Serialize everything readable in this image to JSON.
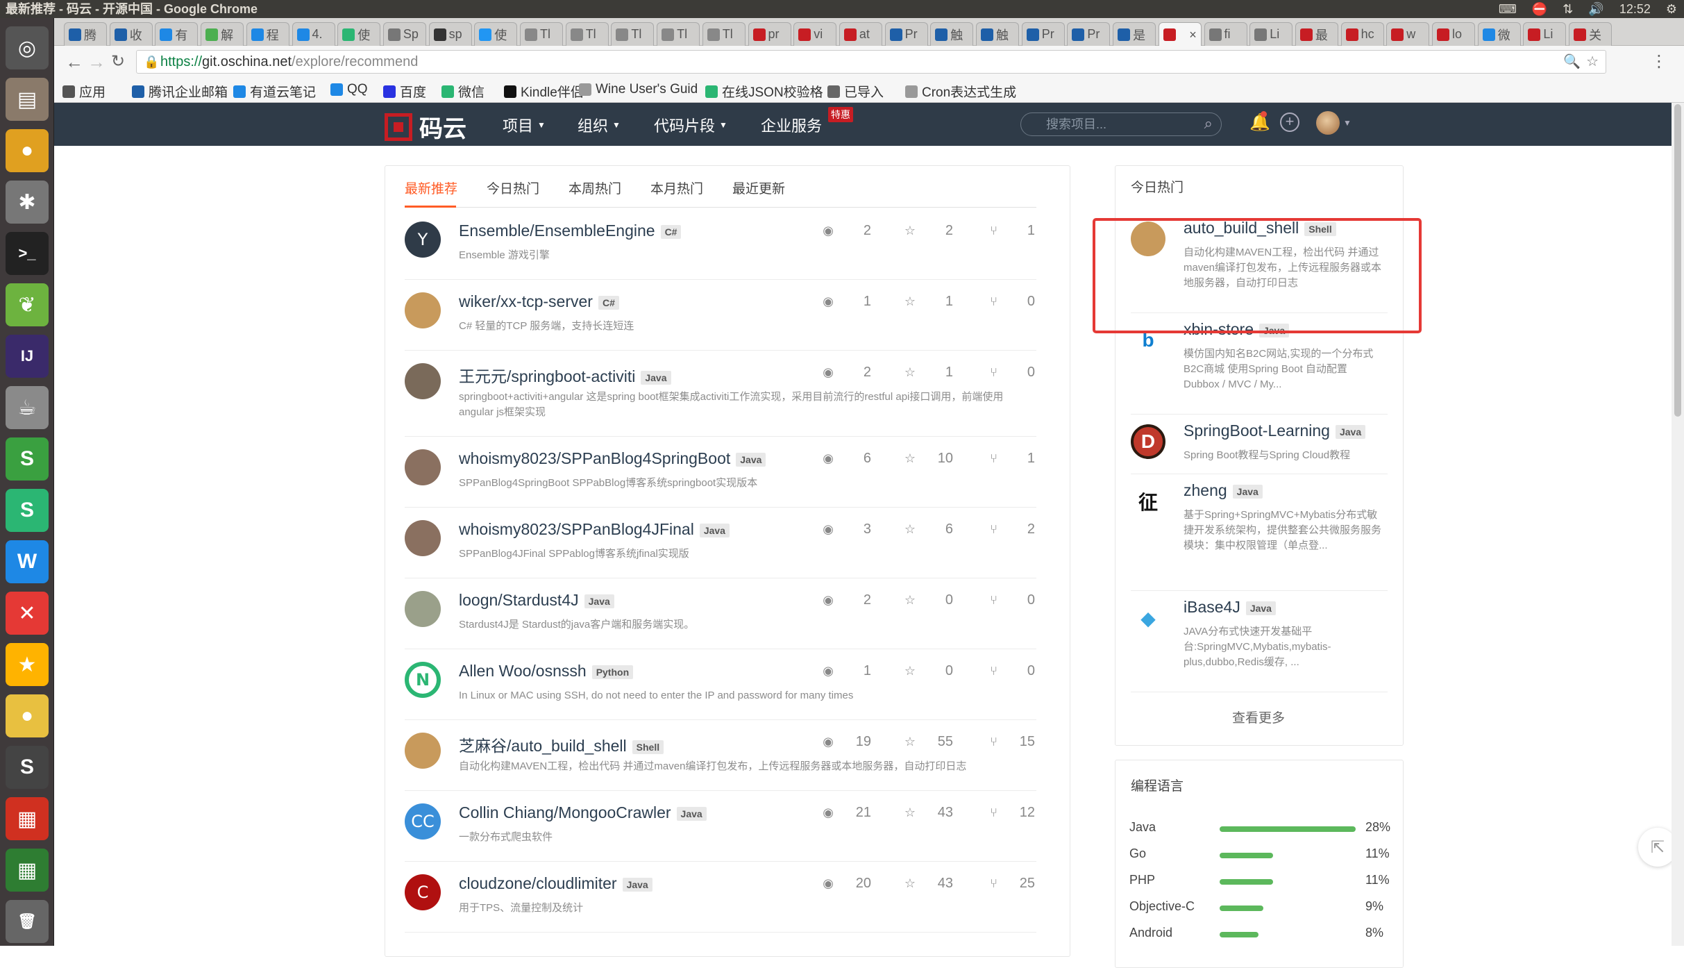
{
  "window_title": "最新推荐 - 码云 - 开源中国 - Google Chrome",
  "system_tray": {
    "time": "12:52"
  },
  "browser": {
    "tabs": [
      {
        "label": "腾",
        "color": "#1e5fa8"
      },
      {
        "label": "收",
        "color": "#1e5fa8"
      },
      {
        "label": "有",
        "color": "#1e88e5"
      },
      {
        "label": "解",
        "color": "#4caf50"
      },
      {
        "label": "程",
        "color": "#1e88e5"
      },
      {
        "label": "4.",
        "color": "#1e88e5"
      },
      {
        "label": "使",
        "color": "#2bb673"
      },
      {
        "label": "Sp",
        "color": "#777"
      },
      {
        "label": "sp",
        "color": "#333"
      },
      {
        "label": "使",
        "color": "#2196f3"
      },
      {
        "label": "Tl",
        "color": "#888"
      },
      {
        "label": "Tl",
        "color": "#888"
      },
      {
        "label": "Tl",
        "color": "#888"
      },
      {
        "label": "Tl",
        "color": "#888"
      },
      {
        "label": "Tl",
        "color": "#888"
      },
      {
        "label": "pr",
        "color": "#c71d23"
      },
      {
        "label": "vi",
        "color": "#c71d23"
      },
      {
        "label": "at",
        "color": "#c71d23"
      },
      {
        "label": "Pr",
        "color": "#1e5fa8"
      },
      {
        "label": "触",
        "color": "#1e5fa8"
      },
      {
        "label": "触",
        "color": "#1e5fa8"
      },
      {
        "label": "Pr",
        "color": "#1e5fa8"
      },
      {
        "label": "Pr",
        "color": "#1e5fa8"
      },
      {
        "label": "是",
        "color": "#1e5fa8"
      },
      {
        "label": "",
        "color": "#c71d23",
        "active": true
      },
      {
        "label": "fi",
        "color": "#777"
      },
      {
        "label": "Li",
        "color": "#777"
      },
      {
        "label": "最",
        "color": "#c71d23"
      },
      {
        "label": "hc",
        "color": "#c71d23"
      },
      {
        "label": "w",
        "color": "#c71d23"
      },
      {
        "label": "lo",
        "color": "#c71d23"
      },
      {
        "label": "微",
        "color": "#1e88e5"
      },
      {
        "label": "Li",
        "color": "#c71d23"
      },
      {
        "label": "关",
        "color": "#c71d23"
      }
    ],
    "url_scheme": "https://",
    "url_host": "git.oschina.net",
    "url_path": "/explore/recommend",
    "bookmarks": [
      {
        "label": "应用",
        "color": "#555"
      },
      {
        "label": "腾讯企业邮箱",
        "color": "#1e5fa8"
      },
      {
        "label": "有道云笔记",
        "color": "#1e88e5"
      },
      {
        "label": "QQ",
        "color": "#1e88e5"
      },
      {
        "label": "百度",
        "color": "#2932e1"
      },
      {
        "label": "微信",
        "color": "#2bb673"
      },
      {
        "label": "Kindle伴侣",
        "color": "#111"
      },
      {
        "label": "Wine User's Guid",
        "color": "#999"
      },
      {
        "label": "在线JSON校验格",
        "color": "#2bb673"
      },
      {
        "label": "已导入",
        "color": "#666"
      },
      {
        "label": "Cron表达式生成",
        "color": "#999"
      }
    ]
  },
  "site": {
    "logo_text": "码云",
    "menus": [
      "项目",
      "组织",
      "代码片段",
      "企业服务"
    ],
    "hot_badge": "特惠",
    "search_placeholder": "搜索项目..."
  },
  "feed": {
    "tabs": [
      "最新推荐",
      "今日热门",
      "本周热门",
      "本月热门",
      "最近更新"
    ],
    "repos": [
      {
        "name": "Ensemble/EnsembleEngine",
        "lang": "C#",
        "desc": "Ensemble 游戏引擎",
        "watch": "2",
        "star": "2",
        "fork": "1",
        "avatar_text": "Y",
        "avatar_color": "#2f3b48"
      },
      {
        "name": "wiker/xx-tcp-server",
        "lang": "C#",
        "desc": "C# 轻量的TCP 服务端，支持长连短连",
        "watch": "1",
        "star": "1",
        "fork": "0",
        "avatar_text": "",
        "avatar_color": "#c89a5c"
      },
      {
        "name": "王元元/springboot-activiti",
        "lang": "Java",
        "desc": "springboot+activiti+angular 这是spring boot框架集成activiti工作流实现，采用目前流行的restful api接口调用，前端使用angular js框架实现",
        "watch": "2",
        "star": "1",
        "fork": "0",
        "avatar_text": "",
        "avatar_color": "#7a6a5a"
      },
      {
        "name": "whoismy8023/SPPanBlog4SpringBoot",
        "lang": "Java",
        "desc": "SPPanBlog4SpringBoot SPPabBlog博客系统springboot实现版本",
        "watch": "6",
        "star": "10",
        "fork": "1",
        "avatar_text": "",
        "avatar_color": "#8a7060"
      },
      {
        "name": "whoismy8023/SPPanBlog4JFinal",
        "lang": "Java",
        "desc": "SPPanBlog4JFinal SPPablog博客系统jfinal实现版",
        "watch": "3",
        "star": "6",
        "fork": "2",
        "avatar_text": "",
        "avatar_color": "#8a7060"
      },
      {
        "name": "loogn/Stardust4J",
        "lang": "Java",
        "desc": "Stardust4J是 Stardust的java客户端和服务端实现。",
        "watch": "2",
        "star": "0",
        "fork": "0",
        "avatar_text": "",
        "avatar_color": "#9aa08a"
      },
      {
        "name": "Allen Woo/osnssh",
        "lang": "Python",
        "desc": "In Linux or MAC using SSH, do not need to enter the IP and password for many times",
        "watch": "1",
        "star": "0",
        "fork": "0",
        "avatar_text": "N",
        "avatar_color": "#2bb673"
      },
      {
        "name": "芝麻谷/auto_build_shell",
        "lang": "Shell",
        "desc": "自动化构建MAVEN工程，检出代码 并通过maven编译打包发布，上传远程服务器或本地服务器，自动打印日志",
        "watch": "19",
        "star": "55",
        "fork": "15",
        "avatar_text": "",
        "avatar_color": "#c89a5c"
      },
      {
        "name": "Collin Chiang/MongooCrawler",
        "lang": "Java",
        "desc": "一款分布式爬虫软件",
        "watch": "21",
        "star": "43",
        "fork": "12",
        "avatar_text": "CC",
        "avatar_color": "#3a8fd9"
      },
      {
        "name": "cloudzone/cloudlimiter",
        "lang": "Java",
        "desc": "用于TPS、流量控制及统计",
        "watch": "20",
        "star": "43",
        "fork": "25",
        "avatar_text": "C",
        "avatar_color": "#b01010"
      }
    ]
  },
  "sidebar": {
    "hot_title": "今日热门",
    "hot": [
      {
        "name": "auto_build_shell",
        "lang": "Shell",
        "desc": "自动化构建MAVEN工程，检出代码 并通过maven编译打包发布，上传远程服务器或本地服务器，自动打印日志",
        "avatar_text": "",
        "avatar_color": "#c89a5c",
        "text_color": "#fff"
      },
      {
        "name": "xbin-store",
        "lang": "Java",
        "desc": "模仿国内知名B2C网站,实现的一个分布式B2C商城 使用Spring Boot 自动配置 Dubbox / MVC / My...",
        "avatar_text": "b",
        "avatar_color": "#ffffff",
        "text_color": "#0f7fd0"
      },
      {
        "name": "SpringBoot-Learning",
        "lang": "Java",
        "desc": "Spring Boot教程与Spring Cloud教程",
        "avatar_text": "D",
        "avatar_color": "#c0392b",
        "text_color": "#fff"
      },
      {
        "name": "zheng",
        "lang": "Java",
        "desc": "基于Spring+SpringMVC+Mybatis分布式敏捷开发系统架构，提供整套公共微服务服务模块：集中权限管理（单点登...",
        "avatar_text": "征",
        "avatar_color": "#ffffff",
        "text_color": "#111"
      },
      {
        "name": "iBase4J",
        "lang": "Java",
        "desc": "JAVA分布式快速开发基础平台:SpringMVC,Mybatis,mybatis-plus,dubbo,Redis缓存, ...",
        "avatar_text": "◆",
        "avatar_color": "#ffffff",
        "text_color": "#3aa6e0"
      }
    ],
    "more_label": "查看更多",
    "lang_title": "编程语言",
    "languages": [
      {
        "name": "Java",
        "pct": "28%",
        "value": 28
      },
      {
        "name": "Go",
        "pct": "11%",
        "value": 11
      },
      {
        "name": "PHP",
        "pct": "11%",
        "value": 11
      },
      {
        "name": "Objective-C",
        "pct": "9%",
        "value": 9
      },
      {
        "name": "Android",
        "pct": "8%",
        "value": 8
      }
    ]
  },
  "launcher": [
    {
      "name": "dash",
      "glyph": "◎",
      "color": "#555"
    },
    {
      "name": "files",
      "glyph": "▤",
      "color": "#8a7a6a"
    },
    {
      "name": "chrome",
      "glyph": "●",
      "color": "#e0a020"
    },
    {
      "name": "settings",
      "glyph": "✱",
      "color": "#777"
    },
    {
      "name": "terminal",
      "glyph": ">_",
      "color": "#222"
    },
    {
      "name": "spring",
      "glyph": "❦",
      "color": "#6db33f"
    },
    {
      "name": "intellij",
      "glyph": "IJ",
      "color": "#3a2a6a"
    },
    {
      "name": "teapot",
      "glyph": "☕",
      "color": "#8a8a8a"
    },
    {
      "name": "sublime-s",
      "glyph": "S",
      "color": "#3aa040"
    },
    {
      "name": "sublime-2",
      "glyph": "S",
      "color": "#2bb673"
    },
    {
      "name": "writer",
      "glyph": "W",
      "color": "#1e88e5"
    },
    {
      "name": "xmind",
      "glyph": "✕",
      "color": "#e53935"
    },
    {
      "name": "star",
      "glyph": "★",
      "color": "#ffb300"
    },
    {
      "name": "egg",
      "glyph": "●",
      "color": "#e8c040"
    },
    {
      "name": "editor",
      "glyph": "S",
      "color": "#444"
    },
    {
      "name": "redis",
      "glyph": "▦",
      "color": "#d03020"
    },
    {
      "name": "calc",
      "glyph": "▦",
      "color": "#2e7d32"
    },
    {
      "name": "trash",
      "glyph": "🗑",
      "color": "#666"
    }
  ]
}
